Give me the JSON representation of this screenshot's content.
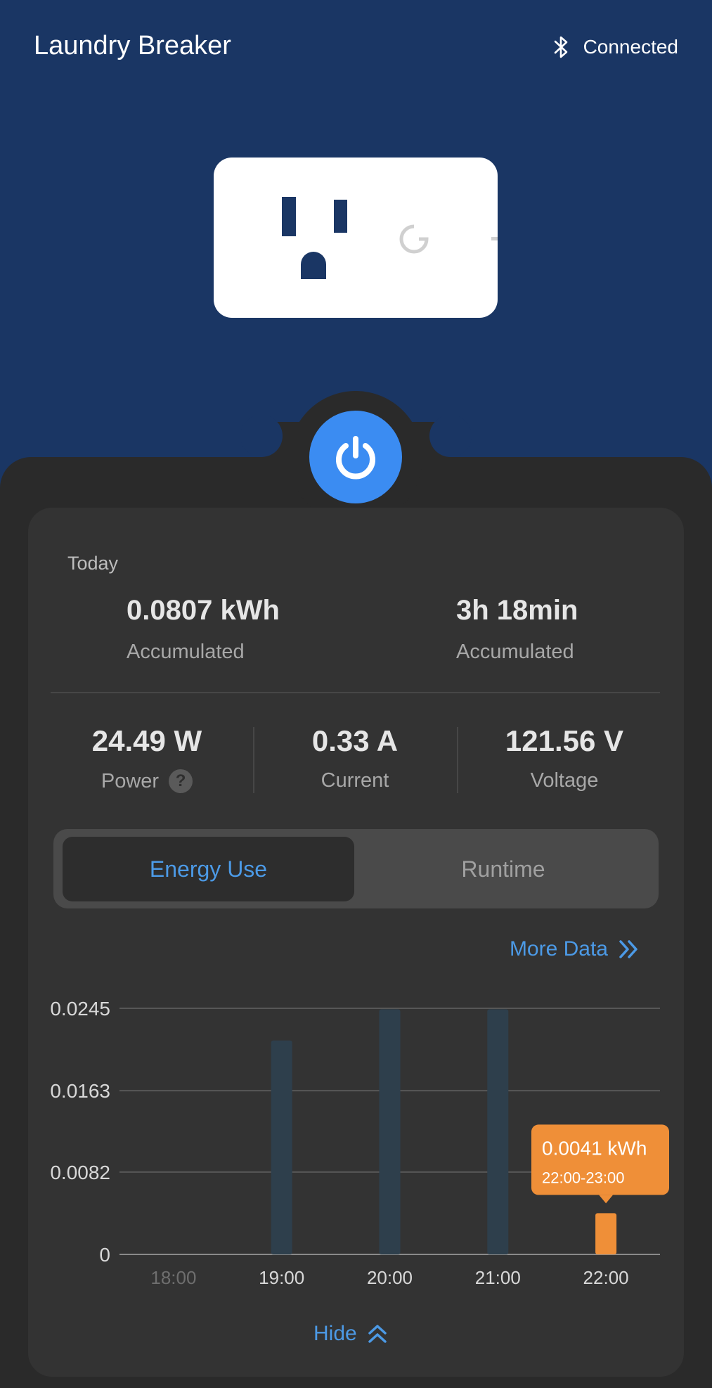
{
  "header": {
    "title": "Laundry Breaker",
    "status": "Connected"
  },
  "summary": {
    "today_label": "Today",
    "energy_value": "0.0807 kWh",
    "energy_label": "Accumulated",
    "runtime_value": "3h 18min",
    "runtime_label": "Accumulated"
  },
  "metrics": [
    {
      "value": "24.49 W",
      "label": "Power"
    },
    {
      "value": "0.33 A",
      "label": "Current"
    },
    {
      "value": "121.56 V",
      "label": "Voltage"
    }
  ],
  "help_symbol": "?",
  "tabs": {
    "active": "Energy Use",
    "inactive": "Runtime"
  },
  "more_data": "More Data",
  "hide": "Hide",
  "colors": {
    "header_bg": "#1a3664",
    "accent": "#3b8cf2",
    "bar": "#2e3f4c",
    "highlight": "#ef8f38"
  },
  "icons": [
    "bluetooth-icon",
    "outlet-graphic",
    "power-icon",
    "help-icon",
    "double-chevron-right-icon",
    "double-chevron-up-icon"
  ],
  "chart_data": {
    "type": "bar",
    "categories": [
      "18:00",
      "19:00",
      "20:00",
      "21:00",
      "22:00"
    ],
    "values": [
      0,
      0.0213,
      0.0244,
      0.0244,
      0.0041
    ],
    "yticks": [
      "0",
      "0.0082",
      "0.0163",
      "0.0245"
    ],
    "ylim": [
      0,
      0.0245
    ],
    "grid": true,
    "highlight_index": 4,
    "tooltip": {
      "value": "0.0041 kWh",
      "range": "22:00-23:00"
    }
  }
}
